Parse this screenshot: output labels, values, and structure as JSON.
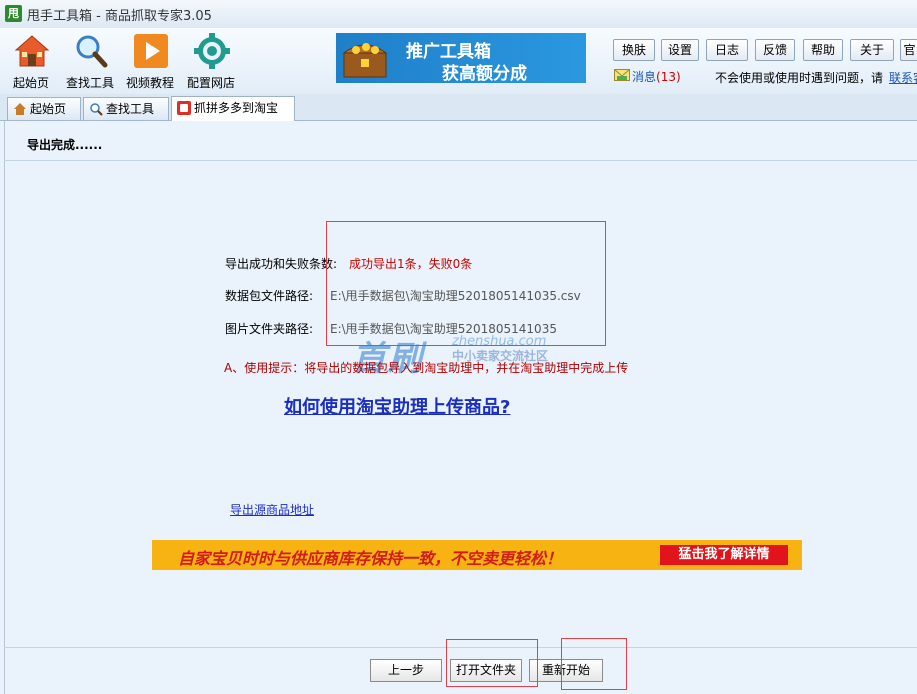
{
  "window": {
    "logo_char": "甩",
    "title": "甩手工具箱 - 商品抓取专家3.05"
  },
  "toolbar": {
    "items": [
      {
        "label": "起始页",
        "icon": "home-icon"
      },
      {
        "label": "查找工具",
        "icon": "magnifier-icon"
      },
      {
        "label": "视频教程",
        "icon": "play-icon"
      },
      {
        "label": "配置网店",
        "icon": "gear-icon"
      }
    ]
  },
  "promo": {
    "line1": "推广工具箱",
    "line2": "获高额分成"
  },
  "top_buttons": [
    "换肤",
    "设置",
    "日志",
    "反馈",
    "帮助",
    "关于",
    "官"
  ],
  "messages": {
    "label": "消息",
    "count": "(13)"
  },
  "help_text": "不会使用或使用时遇到问题，请",
  "contact_link": "联系客服",
  "tabs": [
    {
      "label": "起始页",
      "icon": "home-icon"
    },
    {
      "label": "查找工具",
      "icon": "magnifier-icon"
    },
    {
      "label": "抓拼多多到淘宝",
      "icon": "pdd-icon",
      "active": true
    }
  ],
  "content": {
    "status": "导出完成......",
    "rows": [
      {
        "label": "导出成功和失败条数:",
        "value": "成功导出1条，失败0条"
      },
      {
        "label": "数据包文件路径:",
        "value": "E:\\甩手数据包\\淘宝助理5201805141035.csv"
      },
      {
        "label": "图片文件夹路径:",
        "value": "E:\\甩手数据包\\淘宝助理5201805141035"
      }
    ],
    "tip": "A、使用提示：将导出的数据包导入到淘宝助理中，并在淘宝助理中完成上传",
    "howto_link": "如何使用淘宝助理上传商品?",
    "source_link": "导出源商品地址"
  },
  "ad": {
    "text": "自家宝贝时时与供应商库存保持一致，不空卖更轻松！",
    "button": "猛击我了解详情"
  },
  "watermark": {
    "logo": "首刷",
    "url": "zhenshua.com",
    "caption": "中小卖家交流社区"
  },
  "bottom_buttons": {
    "prev": "上一步",
    "open_folder": "打开文件夹",
    "restart": "重新开始"
  }
}
